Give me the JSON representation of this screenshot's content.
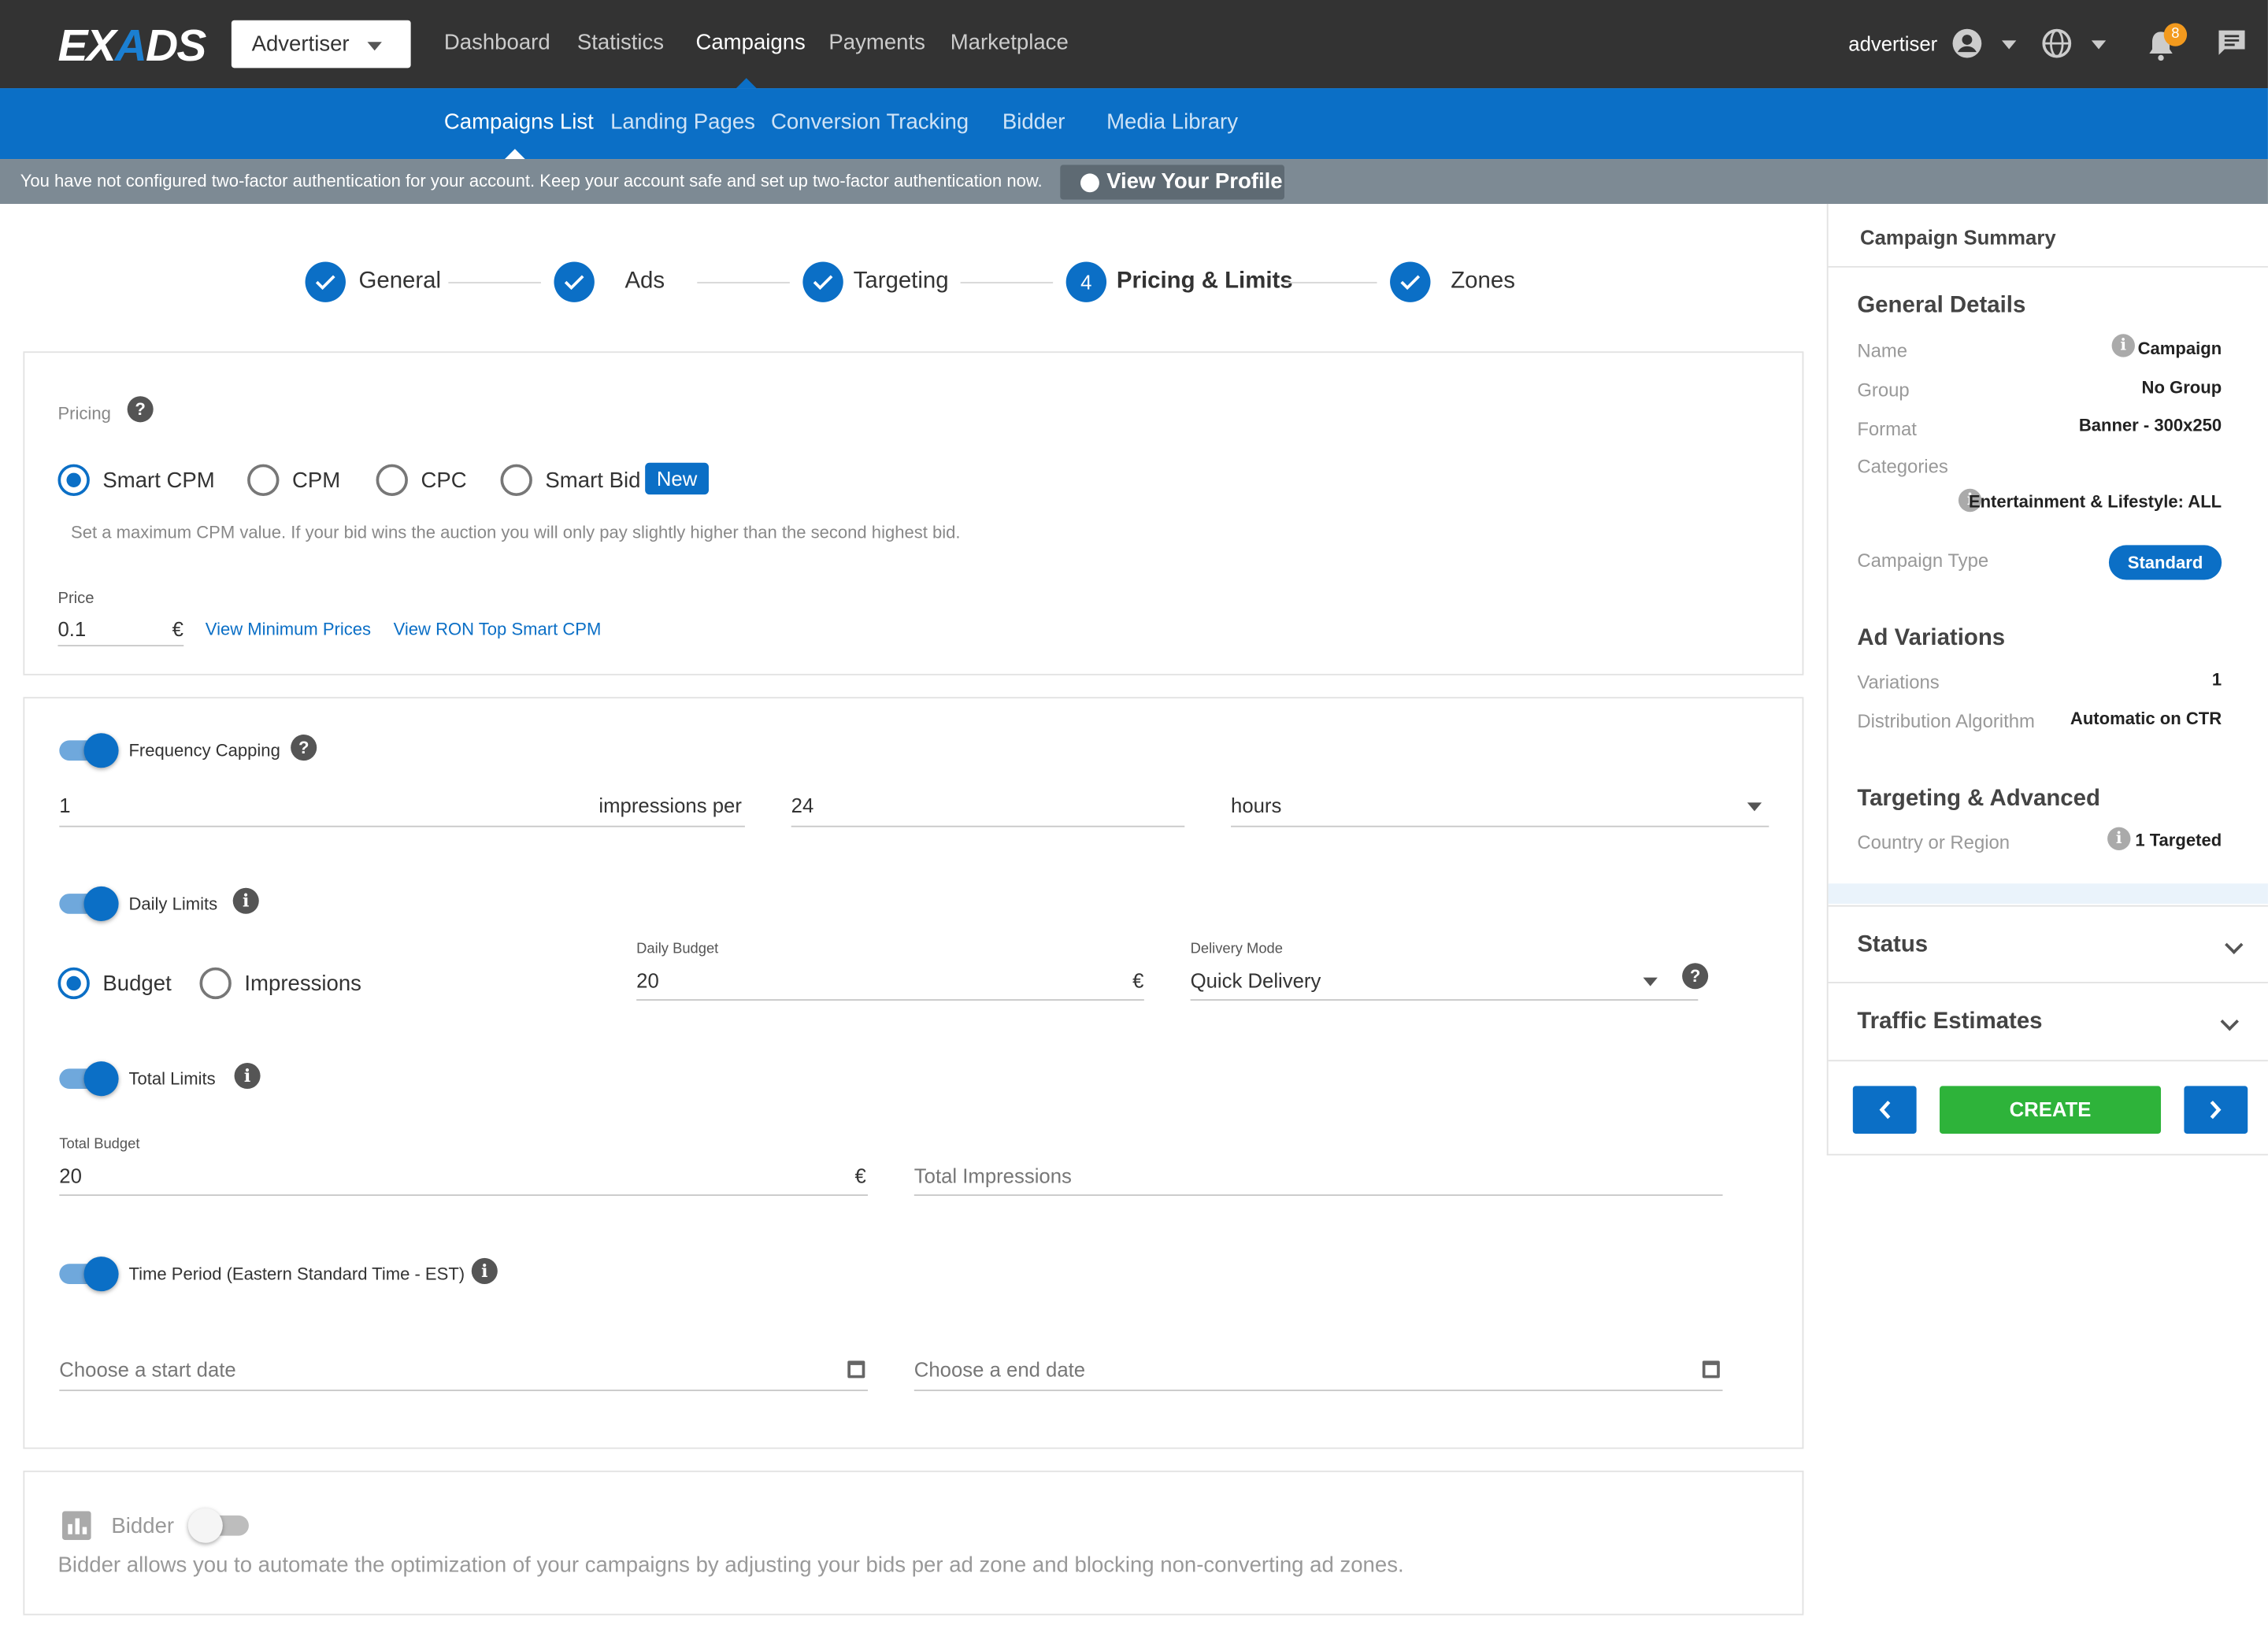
{
  "brand": {
    "logo_text": "EXADS"
  },
  "topnav": {
    "role_select": "Advertiser",
    "items": [
      "Dashboard",
      "Statistics",
      "Campaigns",
      "Payments",
      "Marketplace"
    ],
    "active": "Campaigns",
    "user_label": "advertiser",
    "notification_count": "8"
  },
  "subnav": {
    "items": [
      "Campaigns List",
      "Landing Pages",
      "Conversion Tracking",
      "Bidder",
      "Media Library"
    ],
    "active": "Campaigns List"
  },
  "tfa": {
    "message": "You have not configured two-factor authentication for your account. Keep your account safe and set up two-factor authentication now.",
    "button": "View Your Profile"
  },
  "stepper": {
    "steps": [
      {
        "label": "General",
        "state": "done"
      },
      {
        "label": "Ads",
        "state": "done"
      },
      {
        "label": "Targeting",
        "state": "done"
      },
      {
        "label": "Pricing & Limits",
        "state": "active",
        "number": "4"
      },
      {
        "label": "Zones",
        "state": "done"
      }
    ]
  },
  "pricing": {
    "label": "Pricing",
    "options": [
      "Smart CPM",
      "CPM",
      "CPC",
      "Smart Bid"
    ],
    "selected": "Smart CPM",
    "new_badge": "New",
    "help_text": "Set a maximum CPM value. If your bid wins the auction you will only pay slightly higher than the second highest bid.",
    "price_label": "Price",
    "price_value": "0.1",
    "currency": "€",
    "link_min_prices": "View Minimum Prices",
    "link_ron": "View RON Top Smart CPM"
  },
  "limits": {
    "frequency_capping": {
      "label": "Frequency Capping",
      "enabled": true,
      "impressions": "1",
      "per_label": "impressions per",
      "period_value": "24",
      "period_unit": "hours"
    },
    "daily_limits": {
      "label": "Daily Limits",
      "enabled": true,
      "options": [
        "Budget",
        "Impressions"
      ],
      "selected": "Budget",
      "daily_budget_label": "Daily Budget",
      "daily_budget_value": "20",
      "currency": "€",
      "delivery_mode_label": "Delivery Mode",
      "delivery_mode_value": "Quick Delivery"
    },
    "total_limits": {
      "label": "Total Limits",
      "enabled": true,
      "total_budget_label": "Total Budget",
      "total_budget_value": "20",
      "currency": "€",
      "total_impressions_placeholder": "Total Impressions"
    },
    "time_period": {
      "label": "Time Period (Eastern Standard Time - EST)",
      "enabled": true,
      "start_placeholder": "Choose a start date",
      "end_placeholder": "Choose a end date"
    }
  },
  "bidder": {
    "label": "Bidder",
    "enabled": false,
    "description": "Bidder allows you to automate the optimization of your campaigns by adjusting your bids per ad zone and blocking non-converting ad zones."
  },
  "summary": {
    "title": "Campaign Summary",
    "general": {
      "heading": "General Details",
      "name_k": "Name",
      "name_v": "Campaign",
      "group_k": "Group",
      "group_v": "No Group",
      "format_k": "Format",
      "format_v": "Banner - 300x250",
      "categories_k": "Categories",
      "categories_v": "Entertainment & Lifestyle: ALL",
      "type_k": "Campaign Type",
      "type_v": "Standard"
    },
    "ad_variations": {
      "heading": "Ad Variations",
      "variations_k": "Variations",
      "variations_v": "1",
      "algo_k": "Distribution Algorithm",
      "algo_v": "Automatic on CTR"
    },
    "targeting": {
      "heading": "Targeting & Advanced",
      "country_k": "Country or Region",
      "country_v": "1 Targeted"
    },
    "status_label": "Status",
    "traffic_label": "Traffic Estimates",
    "create_label": "CREATE"
  },
  "colors": {
    "primary": "#0b6fc6",
    "topbar": "#333333",
    "create": "#2eb33a",
    "tfa_bar": "#7d8a94",
    "badge_orange": "#f39a1e"
  }
}
